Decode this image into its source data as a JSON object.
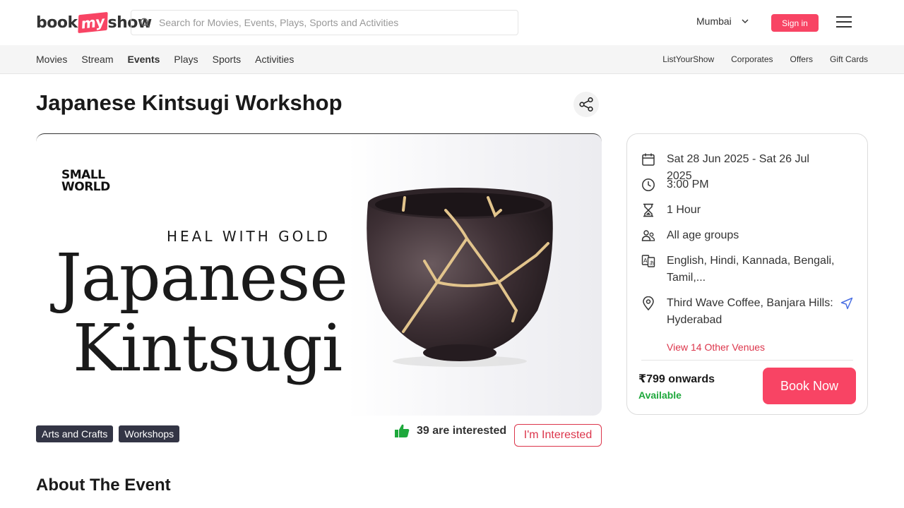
{
  "header": {
    "logo": {
      "book": "book",
      "my": "my",
      "show": "show"
    },
    "search_placeholder": "Search for Movies, Events, Plays, Sports and Activities",
    "city": "Mumbai",
    "signin_label": "Sign in"
  },
  "subnav": {
    "left": [
      "Movies",
      "Stream",
      "Events",
      "Plays",
      "Sports",
      "Activities"
    ],
    "active": "Events",
    "right": [
      "ListYourShow",
      "Corporates",
      "Offers",
      "Gift Cards"
    ]
  },
  "event": {
    "title": "Japanese Kintsugi Workshop",
    "banner": {
      "brand_line1": "SMALL",
      "brand_line2": "WORLD",
      "tagline": "HEAL WITH GOLD",
      "headline1": "Japanese",
      "headline2": "Kintsugi"
    },
    "tags": [
      "Arts and Crafts",
      "Workshops"
    ],
    "interested_count": "39 are interested",
    "interested_button": "I'm Interested",
    "about_heading": "About The Event"
  },
  "details": {
    "dates": "Sat 28 Jun 2025 - Sat 26 Jul 2025",
    "time": "3:00 PM",
    "duration": "1 Hour",
    "age": "All age groups",
    "languages": "English, Hindi, Kannada, Bengali, Tamil,...",
    "venue": "Third Wave Coffee, Banjara Hills: Hyderabad",
    "other_venues": "View 14 Other Venues",
    "price": "₹799 onwards",
    "availability": "Available",
    "book_label": "Book Now"
  },
  "colors": {
    "brand": "#f84464",
    "tag_bg": "#333545",
    "available": "#1ea83c",
    "link": "#dc354b"
  }
}
